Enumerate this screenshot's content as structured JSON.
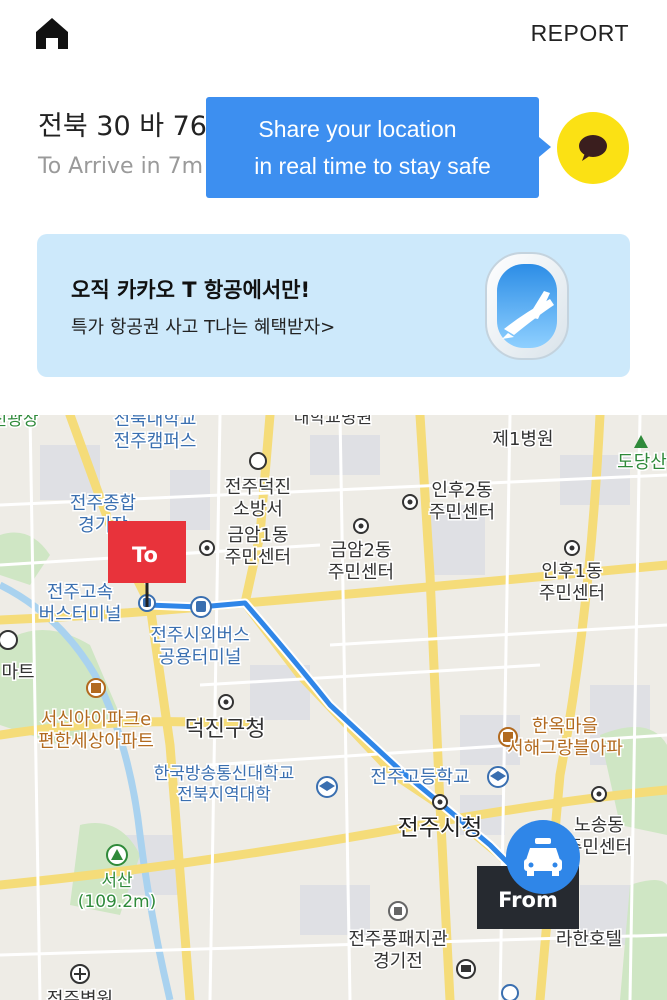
{
  "header": {
    "home_icon": "home-icon",
    "report_label": "REPORT"
  },
  "ride": {
    "plate": "전북 30 바 76",
    "eta": "To Arrive in 7m"
  },
  "tooltip": {
    "line1": "Share your location",
    "line2": "in real time to stay safe",
    "bg_color": "#3d8ff0"
  },
  "share": {
    "icon": "kakaotalk-bubble-icon",
    "bg_color": "#fbe114"
  },
  "banner": {
    "title": "오직 카카오 T 항공에서만!",
    "subtitle": "특가 항공권 사고 T나는 혜택받자>",
    "icon": "airplane-window-icon",
    "bg_color": "#cde9fb"
  },
  "map": {
    "route_color": "#2f86e8",
    "to_marker": "To",
    "from_marker": "From",
    "labels": [
      {
        "id": "university-campus",
        "lines": [
          "전북대학교",
          "전주캠퍼스"
        ],
        "color": "#3a6fb0"
      },
      {
        "id": "hospital-top",
        "text": "대학교병원",
        "color": "#333"
      },
      {
        "id": "hospital-1",
        "text": "제1병원",
        "color": "#333"
      },
      {
        "id": "dodang",
        "text": "도당산",
        "color": "#2f8a3a"
      },
      {
        "id": "stadium",
        "lines": [
          "전주종합",
          "경기장"
        ],
        "color": "#3a6fb0"
      },
      {
        "id": "fire-station",
        "lines": [
          "전주덕진",
          "소방서"
        ],
        "color": "#333"
      },
      {
        "id": "inhu2",
        "lines": [
          "인후2동",
          "주민센터"
        ],
        "color": "#333"
      },
      {
        "id": "geumam1",
        "lines": [
          "금암1동",
          "주민센터"
        ],
        "color": "#333"
      },
      {
        "id": "geumam2",
        "lines": [
          "금암2동",
          "주민센터"
        ],
        "color": "#333"
      },
      {
        "id": "inhu1",
        "lines": [
          "인후1동",
          "주민센터"
        ],
        "color": "#333"
      },
      {
        "id": "express-bus",
        "lines": [
          "전주고속",
          "버스터미널"
        ],
        "color": "#3a6fb0"
      },
      {
        "id": "intercity-bus",
        "lines": [
          "전주시외버스",
          "공용터미널"
        ],
        "color": "#3a6fb0"
      },
      {
        "id": "mart",
        "text": "마트",
        "color": "#333"
      },
      {
        "id": "apartment",
        "lines": [
          "서신아이파크e",
          "편한세상아파트"
        ],
        "color": "#b26a1f"
      },
      {
        "id": "deokjin-gu",
        "text": "덕진구청",
        "color": "#333"
      },
      {
        "id": "hanok",
        "lines": [
          "한옥마을",
          "서해그랑블아파"
        ],
        "color": "#b26a1f"
      },
      {
        "id": "broadcast-univ",
        "lines": [
          "한국방송통신대학교",
          "전북지역대학"
        ],
        "color": "#3a6fb0"
      },
      {
        "id": "high-school",
        "text": "전주고등학교",
        "color": "#3a6fb0"
      },
      {
        "id": "city-hall",
        "text": "전주시청",
        "color": "#222"
      },
      {
        "id": "nosong",
        "lines": [
          "노송동",
          "주민센터"
        ],
        "color": "#333"
      },
      {
        "id": "seosan",
        "lines": [
          "서산",
          "(109.2m)"
        ],
        "color": "#2f8a3a"
      },
      {
        "id": "pungpae",
        "lines": [
          "전주풍패지관",
          "경기전"
        ],
        "color": "#333"
      },
      {
        "id": "hotel",
        "text": "라한호텔",
        "color": "#333"
      },
      {
        "id": "bottom-hospital",
        "text": "전주병원",
        "color": "#333"
      },
      {
        "id": "left-top",
        "text": "신광장",
        "color": "#2f8a3a"
      }
    ]
  }
}
